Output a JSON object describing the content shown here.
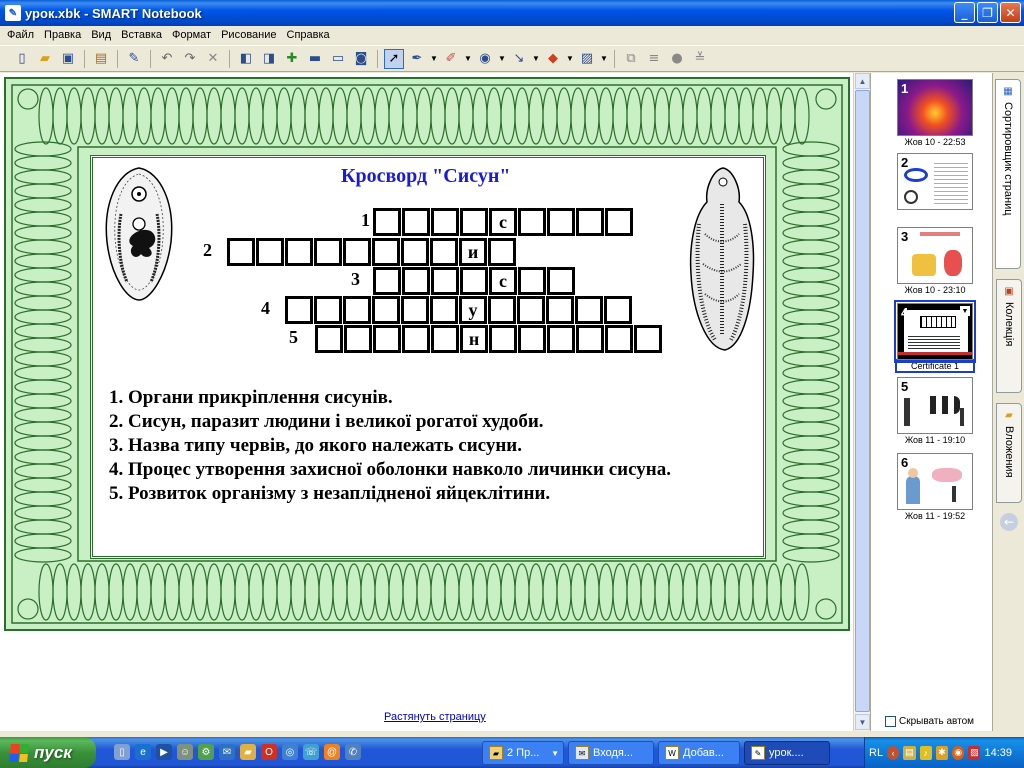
{
  "window": {
    "title": "урок.xbk - SMART Notebook",
    "minimize": "_",
    "maximize": "❐",
    "close": "✕"
  },
  "menu": [
    "Файл",
    "Правка",
    "Вид",
    "Вставка",
    "Формат",
    "Рисование",
    "Справка"
  ],
  "toolbar_icons": [
    "new-page-icon",
    "open-icon",
    "save-icon",
    "paste-icon",
    "settings-icon",
    "undo-icon",
    "redo-icon",
    "delete-icon",
    "prev-page-icon",
    "next-page-icon",
    "add-page-icon",
    "screen-shade-icon",
    "full-screen-icon",
    "camera-icon",
    "select-icon",
    "pen-icon",
    "eraser-icon",
    "shapes-icon",
    "line-icon",
    "fill-icon",
    "properties-icon",
    "group-icon",
    "order-icon",
    "fill-tool-icon",
    "menu-icon"
  ],
  "crossword": {
    "title": "Кросворд \"Сисун\"",
    "rows": [
      {
        "number": "1",
        "letters": [
          "",
          "",
          "",
          "",
          "с",
          "",
          "",
          "",
          ""
        ]
      },
      {
        "number": "2",
        "letters": [
          "",
          "",
          "",
          "",
          "",
          "",
          "",
          "",
          "и",
          ""
        ]
      },
      {
        "number": "3",
        "letters": [
          "",
          "",
          "",
          "",
          "с",
          "",
          ""
        ]
      },
      {
        "number": "4",
        "letters": [
          "",
          "",
          "",
          "",
          "",
          "",
          "у",
          "",
          "",
          "",
          "",
          ""
        ]
      },
      {
        "number": "5",
        "letters": [
          "",
          "",
          "",
          "",
          "",
          "н",
          "",
          "",
          "",
          "",
          "",
          ""
        ]
      }
    ],
    "questions": [
      "1. Органи прикріплення сисунів.",
      "2. Сисун, паразит людини і великої рогатої худоби.",
      "3. Назва типу червів, до якого належать сисуни.",
      "4. Процес утворення захисної оболонки навколо личинки сисуна.",
      "5.  Розвиток організму з незаплідненої яйцеклітини."
    ]
  },
  "stretch_link": "Растянуть страницу",
  "page_sorter": {
    "thumbnails": [
      {
        "number": "1",
        "caption": "Жов 10 - 22:53"
      },
      {
        "number": "2",
        "caption": ""
      },
      {
        "number": "3",
        "caption": "Жов 10 - 23:10"
      },
      {
        "number": "4",
        "caption": "Certificate 1"
      },
      {
        "number": "5",
        "caption": "Жов 11 - 19:10"
      },
      {
        "number": "6",
        "caption": "Жов 11 - 19:52"
      }
    ],
    "selected_index": 3,
    "hide_label": "Скрывать автом"
  },
  "side_tabs": [
    "Сортировщик страниц",
    "Колекція",
    "Вложения"
  ],
  "taskbar": {
    "start": "пуск",
    "tasks": [
      "2 Пр...",
      "Входя...",
      "Добав...",
      "урок...."
    ],
    "lang": "RL",
    "clock": "14:39"
  },
  "colors": {
    "title_blue": "#1a1ad8",
    "frame_green": "#c9efc4",
    "frame_dark": "#2c6e2c",
    "selection_blue": "#1a3fd0"
  }
}
